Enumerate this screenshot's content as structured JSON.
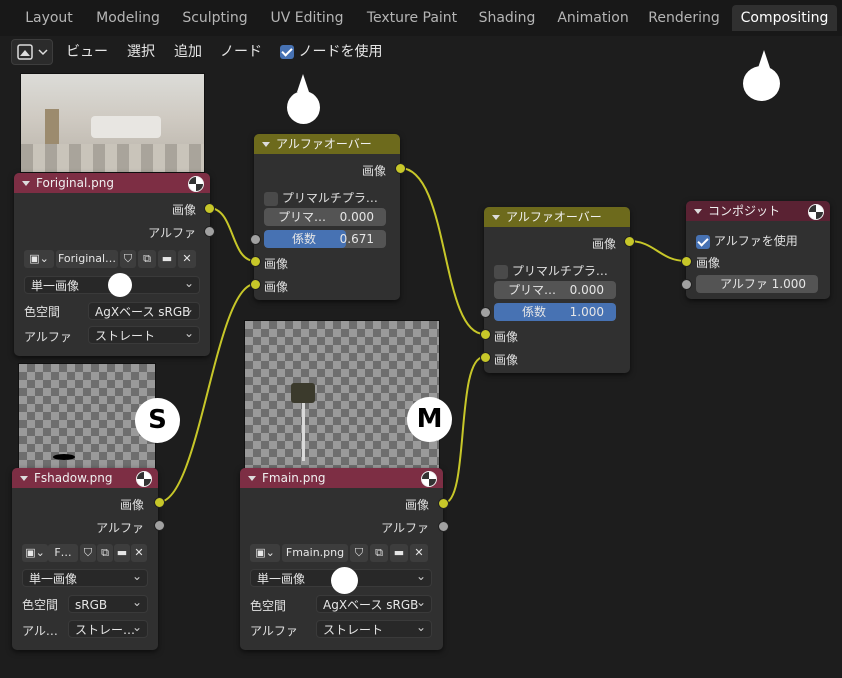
{
  "workspace_tabs": [
    "Layout",
    "Modeling",
    "Sculpting",
    "UV Editing",
    "Texture Paint",
    "Shading",
    "Animation",
    "Rendering",
    "Compositing"
  ],
  "active_tab": "Compositing",
  "header": {
    "menu_view": "ビュー",
    "menu_select": "選択",
    "menu_add": "追加",
    "menu_node": "ノード",
    "use_nodes_label": "ノードを使用",
    "use_nodes_checked": true
  },
  "labels": {
    "image": "画像",
    "alpha": "アルファ",
    "color_space": "色空間",
    "alpha_short": "アル…"
  },
  "nodes": {
    "original": {
      "title": "Foriginal.png",
      "filename": "Foriginal…",
      "source": "単一画像",
      "color_space": "AgXベース sRGB",
      "alpha_mode": "ストレート"
    },
    "alpha_over_1": {
      "title": "アルファオーバー",
      "premultiply_label": "プリマルチプラ…",
      "premultiply_checked": false,
      "premul_field_label": "プリマ…",
      "premul_value": "0.000",
      "factor_label": "係数",
      "factor_value": "0.671",
      "factor_fraction": 0.671
    },
    "alpha_over_2": {
      "title": "アルファオーバー",
      "premultiply_label": "プリマルチプラ…",
      "premultiply_checked": false,
      "premul_field_label": "プリマ…",
      "premul_value": "0.000",
      "factor_label": "係数",
      "factor_value": "1.000",
      "factor_fraction": 1.0
    },
    "composite": {
      "title": "コンポジット",
      "use_alpha_label": "アルファを使用",
      "use_alpha_checked": true,
      "alpha_label": "アルファ",
      "alpha_value": "1.000"
    },
    "shadow": {
      "title": "Fshadow.png",
      "filename": "F…",
      "source": "単一画像",
      "color_space": "sRGB",
      "alpha_mode": "ストレー…"
    },
    "main": {
      "title": "Fmain.png",
      "filename": "Fmain.png",
      "source": "単一画像",
      "color_space": "AgXベース sRGB",
      "alpha_mode": "ストレート"
    }
  },
  "markers": {
    "shadow": "S",
    "main": "M"
  },
  "colors": {
    "image_header": "#7d2e44",
    "mix_header": "#6d6a1c",
    "output_header": "#5a2233",
    "image_socket": "#c7c729",
    "value_socket": "#a1a1a1",
    "accent": "#4772b3"
  }
}
